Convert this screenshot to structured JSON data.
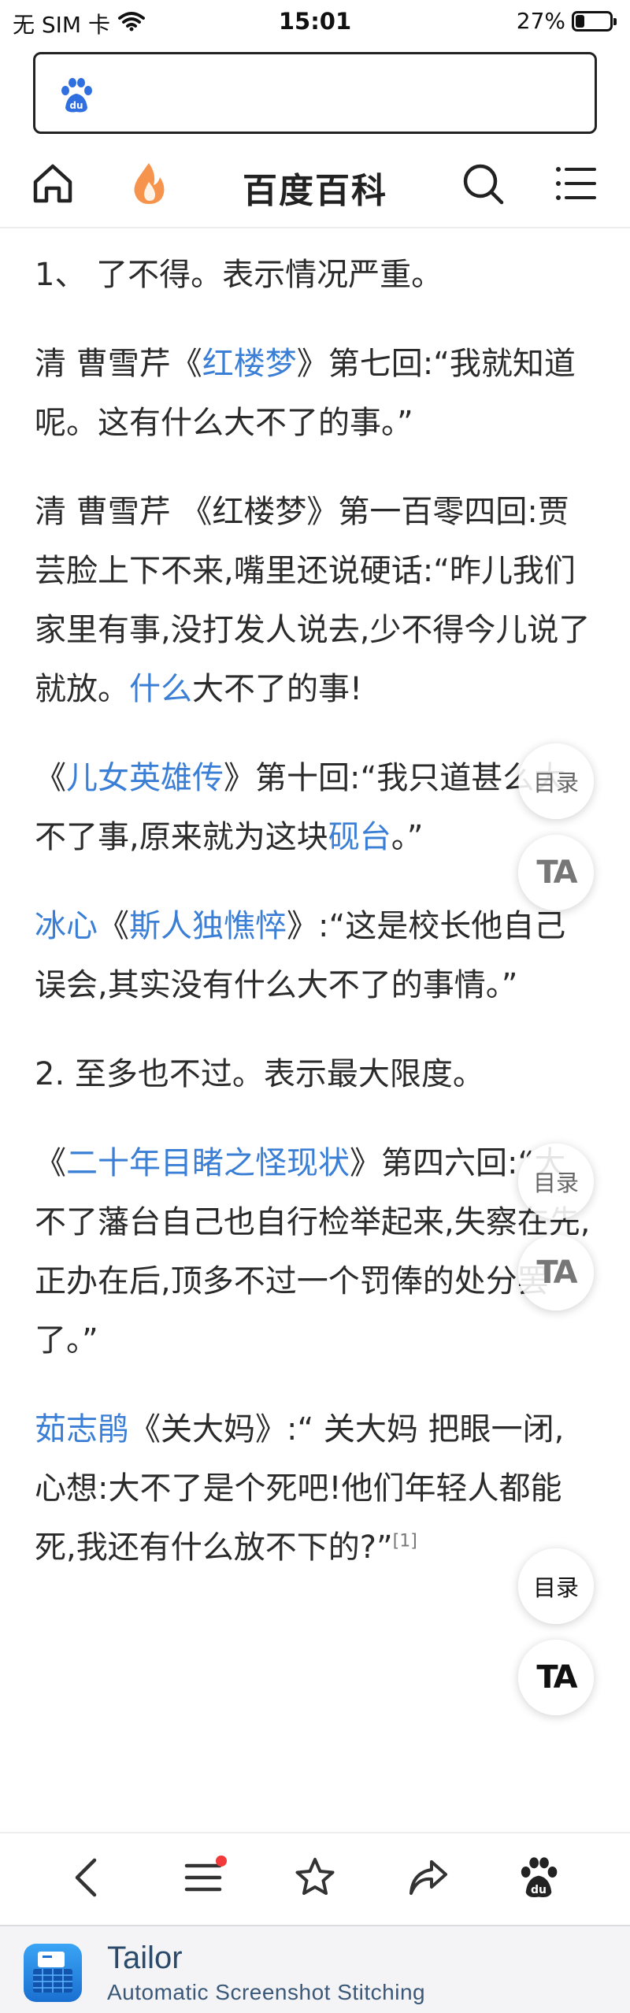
{
  "status_bar": {
    "carrier": "无 SIM 卡",
    "time": "15:01",
    "battery": "27%",
    "battery_level": 0.27
  },
  "search": {
    "placeholder": ""
  },
  "header": {
    "title": "百度百科"
  },
  "article": {
    "p1": "1、 了不得。表示情况严重。",
    "p2a": "清 曹雪芹《",
    "p2_link": "红楼梦",
    "p2b": "》第七回:“我就知道呢。这有什么大不了的事。”",
    "p3a": "清 曹雪芹 《红楼梦》第一百零四回:贾芸脸上下不来,嘴里还说硬话:“昨儿我们家里有事,没打发人说去,少不得今儿说了就放。",
    "p3_link": "什么",
    "p3b": "大不了的事!",
    "p4a": "《",
    "p4_link1": "儿女英雄传",
    "p4b": "》第十回:“我只道甚么大不了事,原来就为这块",
    "p4_link2": "砚台",
    "p4c": "。”",
    "p5_link1": "冰心",
    "p5a": "《",
    "p5_link2": "斯人独憔悴",
    "p5b": "》:“这是校长他自己误会,其实没有什么大不了的事情。”",
    "p6": "2. 至多也不过。表示最大限度。",
    "p7a": "《",
    "p7_link": "二十年目睹之怪现状",
    "p7b": "》第四六回:“大不了藩台自己也自行检举起来,失察在先,正办在后,顶多不过一个罚俸的处分罢了。”",
    "p8_link": "茹志鹃",
    "p8a": "《关大妈》:“ 关大妈 把眼一闭,心想:大不了是个死吧!他们年轻人都能死,我还有什么放不下的?”",
    "p8_ref": "[1]"
  },
  "floating": {
    "toc_label": "目录",
    "ta_label": "TA"
  },
  "toolbar": {
    "icons": [
      "back-icon",
      "menu-icon",
      "star-icon",
      "share-icon",
      "baidu-paw-icon"
    ]
  },
  "tailor": {
    "title": "Tailor",
    "subtitle": "Automatic Screenshot Stitching"
  },
  "colors": {
    "link": "#3a7fd5",
    "accent_flame": "#f5883a",
    "notification_dot": "#f23a3a",
    "baidu_blue": "#2f6fe0"
  }
}
